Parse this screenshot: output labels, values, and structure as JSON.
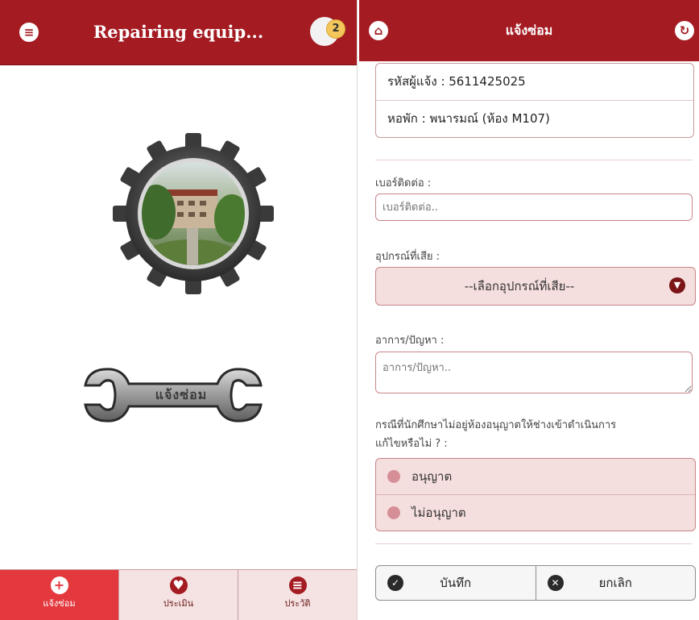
{
  "left": {
    "header": {
      "title": "Repairing equip...",
      "badge_count": "2",
      "menu_icon": "menu-icon"
    },
    "wrench_label": "แจ้งซ่อม",
    "footer": {
      "tabs": [
        {
          "label": "แจ้งซ่อม",
          "icon": "plus-icon",
          "active": true
        },
        {
          "label": "ประเมิน",
          "icon": "heart-icon",
          "active": false
        },
        {
          "label": "ประวัติ",
          "icon": "list-icon",
          "active": false
        }
      ]
    }
  },
  "right": {
    "header": {
      "title": "แจ้งซ่อม",
      "home_icon": "home-icon",
      "refresh_icon": "refresh-icon"
    },
    "info": {
      "reporter_id": "รหัสผู้แจ้ง : 5611425025",
      "dorm": "หอพัก : พนารมณ์ (ห้อง M107)"
    },
    "contact": {
      "label": "เบอร์ติดต่อ :",
      "placeholder": "เบอร์ติดต่อ.."
    },
    "equipment": {
      "label": "อุปกรณ์ที่เสีย :",
      "selected": "--เลือกอุปกรณ์ที่เสีย--"
    },
    "symptom": {
      "label": "อาการ/ปัญหา :",
      "placeholder": "อาการ/ปัญหา.."
    },
    "permission": {
      "question_line1": "กรณีที่นักศึกษาไม่อยู่ห้องอนุญาตให้ช่างเข้าดำเนินการ",
      "question_line2": "แก้ไขหรือไม่ ? :",
      "options": [
        "อนุญาต",
        "ไม่อนุญาต"
      ]
    },
    "actions": {
      "save": "บันทึก",
      "cancel": "ยกเลิก"
    }
  },
  "colors": {
    "primary": "#a41b22",
    "active_tab": "#e3383e",
    "tint": "#f5dede"
  }
}
